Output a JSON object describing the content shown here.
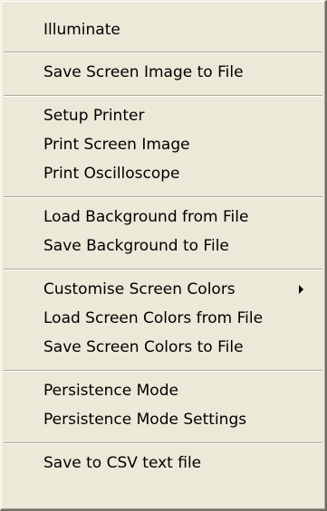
{
  "menu": {
    "items": [
      {
        "label": "Illuminate"
      },
      {
        "label": "Save Screen Image to File"
      },
      {
        "label": "Setup Printer"
      },
      {
        "label": "Print Screen Image"
      },
      {
        "label": "Print Oscilloscope"
      },
      {
        "label": "Load Background from File"
      },
      {
        "label": "Save Background to File"
      },
      {
        "label": "Customise Screen Colors",
        "submenu_icon": "chevron-right-icon"
      },
      {
        "label": "Load Screen Colors from File"
      },
      {
        "label": "Save Screen Colors to File"
      },
      {
        "label": "Persistence Mode"
      },
      {
        "label": "Persistence Mode Settings"
      },
      {
        "label": "Save to CSV text file"
      }
    ]
  },
  "colors": {
    "menu_background": "#ece9d8",
    "separator_dark": "#aca899",
    "separator_light": "#ffffff",
    "text": "#000000"
  }
}
